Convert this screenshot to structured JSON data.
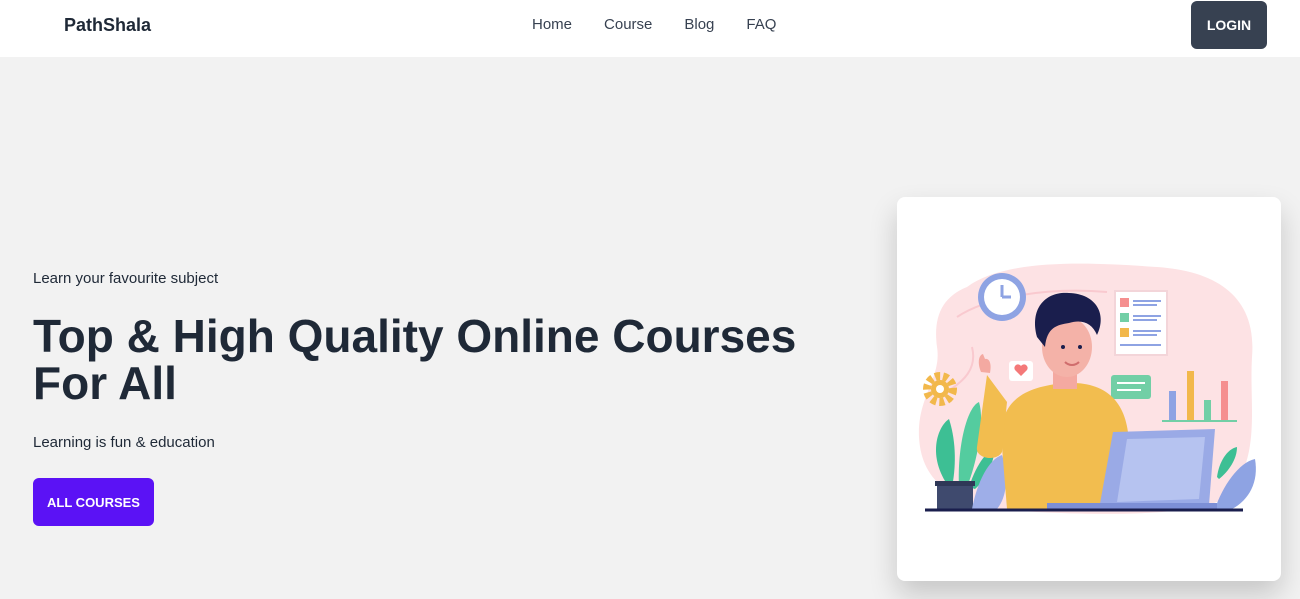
{
  "navbar": {
    "brand": "PathShala",
    "links": [
      "Home",
      "Course",
      "Blog",
      "FAQ"
    ],
    "login_label": "LOGIN"
  },
  "hero": {
    "eyebrow": "Learn your favourite subject",
    "headline_line1": "Top & High Quality Online Courses",
    "headline_line2": "For All",
    "subline": "Learning is fun & education",
    "cta_label": "ALL COURSES"
  },
  "colors": {
    "accent": "#5b12f5",
    "login_bg": "#374151",
    "page_bg": "#f2f2f2"
  },
  "illustration": {
    "name": "student-at-laptop-illustration"
  }
}
